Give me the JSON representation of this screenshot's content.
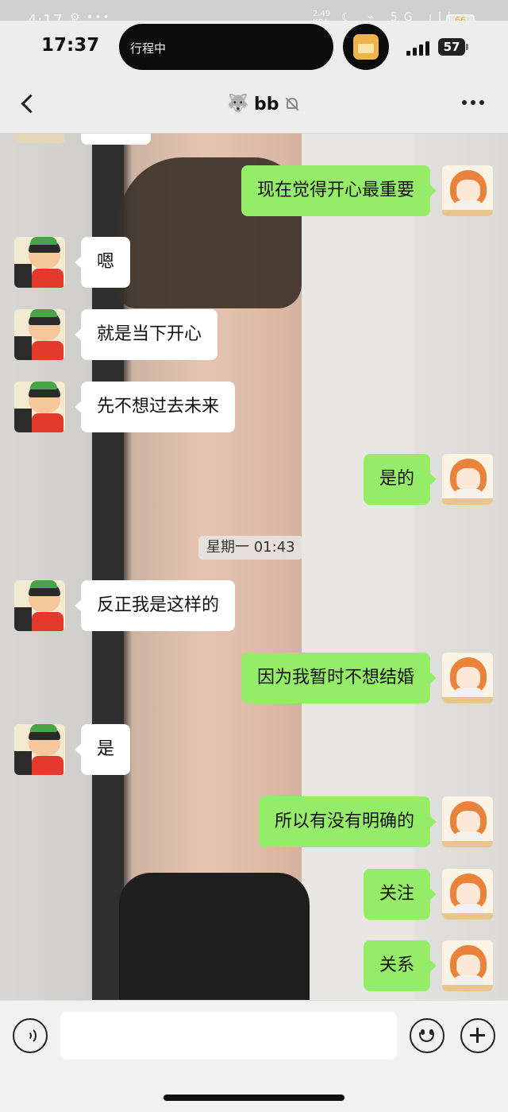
{
  "overlay_status": {
    "time": "4:17",
    "dots": "⚙ •••",
    "speed": "2.49\nKB/s",
    "icons": "☾ ⌁ 5G ıll",
    "battery": "66"
  },
  "status_bar": {
    "time": "17:37",
    "island_text": "行程中",
    "battery": "57"
  },
  "header": {
    "title": "bb"
  },
  "messages": [
    {
      "side": "right",
      "text": "现在觉得开心最重要"
    },
    {
      "side": "left",
      "text": "嗯"
    },
    {
      "side": "left",
      "text": "就是当下开心"
    },
    {
      "side": "left",
      "text": "先不想过去未来"
    },
    {
      "side": "right",
      "text": "是的"
    },
    {
      "side": "left",
      "text": "反正我是这样的"
    },
    {
      "side": "right",
      "text": "因为我暂时不想结婚"
    },
    {
      "side": "left",
      "text": "是"
    },
    {
      "side": "right",
      "text": "所以有没有明确的"
    },
    {
      "side": "right",
      "text": "关注"
    },
    {
      "side": "right",
      "text": "关系"
    }
  ],
  "timestamp": "星期一 01:43",
  "input": {
    "value": "",
    "placeholder": ""
  },
  "colors": {
    "sent_bubble": "#95ec69",
    "received_bubble": "#ffffff",
    "header_bg": "#ededed"
  }
}
